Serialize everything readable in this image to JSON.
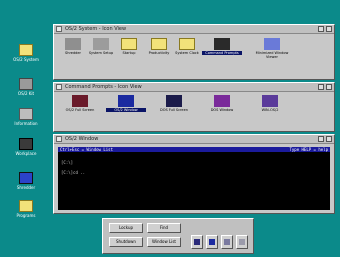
{
  "desktop": {
    "icons": [
      {
        "label": "OS/2 System",
        "icon": "folder-icon"
      },
      {
        "label": "OS/2 Kit",
        "icon": "drive-icon"
      },
      {
        "label": "Information",
        "icon": "info-icon"
      },
      {
        "label": "Workplace",
        "icon": "workplace-icon"
      },
      {
        "label": "Shredder",
        "icon": "shredder-icon"
      },
      {
        "label": "Programs",
        "icon": "folder-icon"
      }
    ]
  },
  "system_window": {
    "title": "OS/2 System - Icon View",
    "objects": [
      {
        "label": "Shredder"
      },
      {
        "label": "System Setup"
      },
      {
        "label": "Startup"
      },
      {
        "label": "Productivity"
      },
      {
        "label": "System Clock"
      },
      {
        "label": "Command Prompts"
      },
      {
        "label": "Minimized Window Viewer"
      }
    ]
  },
  "command_window": {
    "title": "Command Prompts - Icon View",
    "objects": [
      {
        "label": "OS/2 Full Screen"
      },
      {
        "label": "OS/2 Window"
      },
      {
        "label": "DOS Full Screen"
      },
      {
        "label": "DOS Window"
      },
      {
        "label": "WIN-OS/2"
      }
    ]
  },
  "os2_window": {
    "title": "OS/2 Window",
    "header_left": "Ctrl+Esc = Window List",
    "header_right": "Type HELP = help",
    "lines": [
      "",
      "[C:\\]",
      "",
      "[C:\\]cd ..",
      ""
    ]
  },
  "launchpad": {
    "buttons": [
      "Lockup",
      "Find",
      "Shutdown",
      "Window List"
    ]
  }
}
